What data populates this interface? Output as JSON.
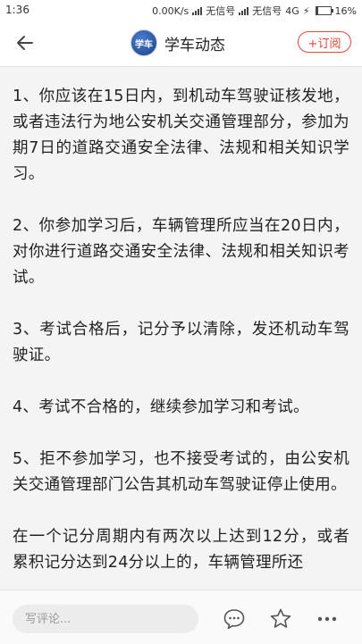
{
  "status_bar": {
    "time": "1:36",
    "speed": "0.00K/s",
    "sim1": "无信号",
    "sim2": "无信号",
    "network": "4G",
    "battery_percent": 16,
    "battery_label": "16%"
  },
  "header": {
    "channel_name": "学车动态",
    "logo_text": "学车",
    "subscribe_label": "+订阅"
  },
  "article": {
    "paragraphs": [
      "1、你应该在15日内，到机动车驾驶证核发地，或者违法行为地公安机关交通管理部分，参加为期7日的道路交通安全法律、法规和相关知识学习。",
      "2、你参加学习后，车辆管理所应当在20日内，对你进行道路交通安全法律、法规和相关知识考试。",
      "3、考试合格后，记分予以清除，发还机动车驾驶证。",
      "4、考试不合格的，继续参加学习和考试。",
      "5、拒不参加学习，也不接受考试的，由公安机关交通管理部门公告其机动车驾驶证停止使用。",
      "在一个记分周期内有两次以上达到12分，或者累积记分达到24分以上的，车辆管理所还"
    ]
  },
  "bottom_bar": {
    "comment_placeholder": "写评论..."
  },
  "icons": {
    "back": "back-arrow-icon",
    "comment": "comment-icon",
    "favorite": "star-icon",
    "more": "more-icon"
  }
}
